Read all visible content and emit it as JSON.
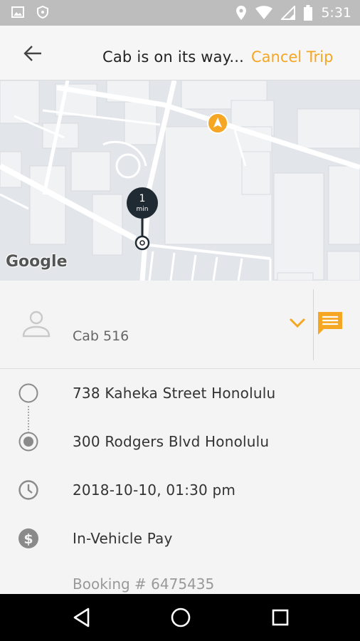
{
  "status_bar": {
    "time": "5:31",
    "icons": [
      "image-icon",
      "shield-icon",
      "location-icon",
      "wifi-icon",
      "signal-icon",
      "battery-icon"
    ]
  },
  "app_bar": {
    "back_icon": "arrow-left-icon",
    "title": "Cab is on its way...",
    "cancel_label": "Cancel Trip"
  },
  "map": {
    "eta_value": "1",
    "eta_unit": "min",
    "logo": "Google",
    "markers": [
      "eta-pin",
      "car-marker-icon",
      "pickup-pin"
    ]
  },
  "driver": {
    "cab_name": "Cab 516",
    "avatar_icon": "person-icon",
    "expand_icon": "chevron-down-icon",
    "chat_icon": "chat-icon"
  },
  "trip": {
    "pickup": "738 Kaheka Street Honolulu",
    "dropoff": "300 Rodgers Blvd Honolulu",
    "datetime": "2018-10-10, 01:30 pm",
    "payment": "In-Vehicle Pay",
    "booking": "Booking # 6475435"
  },
  "nav_bar": {
    "icons": [
      "back-triangle-icon",
      "home-circle-icon",
      "recents-square-icon"
    ]
  },
  "colors": {
    "accent": "#f5a623",
    "status_bar": "#bdbdbd",
    "background": "#f4f4f4"
  }
}
